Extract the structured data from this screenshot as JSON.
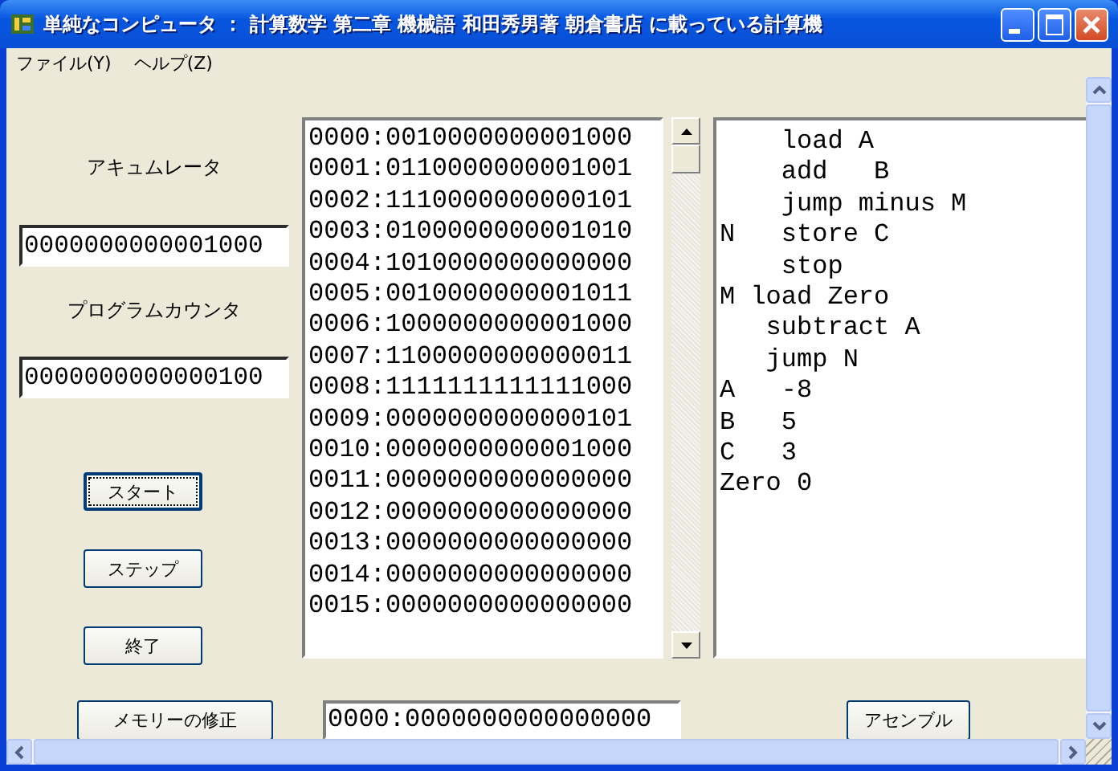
{
  "window": {
    "title": "単純なコンピュータ ： 計算数学 第二章 機械語 和田秀男著 朝倉書店 に載っている計算機"
  },
  "menu": [
    {
      "label": "ファイル(Y)"
    },
    {
      "label": "ヘルプ(Z)"
    }
  ],
  "registers": [
    {
      "label": "アキュムレータ",
      "value": "0000000000001000"
    },
    {
      "label": "プログラムカウンタ",
      "value": "0000000000000100"
    }
  ],
  "buttons": [
    {
      "label": "スタート",
      "focused": true
    },
    {
      "label": "ステップ",
      "focused": false
    },
    {
      "label": "終了",
      "focused": false
    }
  ],
  "memory": [
    "0000:0010000000001000",
    "0001:0110000000001001",
    "0002:1110000000000101",
    "0003:0100000000001010",
    "0004:1010000000000000",
    "0005:0010000000001011",
    "0006:1000000000001000",
    "0007:1100000000000011",
    "0008:1111111111111000",
    "0009:0000000000000101",
    "0010:0000000000001000",
    "0011:0000000000000000",
    "0012:0000000000000000",
    "0013:0000000000000000",
    "0014:0000000000000000",
    "0015:0000000000000000"
  ],
  "code": [
    "    load A",
    "    add   B",
    "    jump minus M",
    "N   store C",
    "    stop",
    "M load Zero",
    "   subtract A",
    "   jump N",
    "A   -8",
    "B   5",
    "C   3",
    "Zero 0"
  ],
  "modify_button": {
    "label": "メモリーの修正"
  },
  "address_field": {
    "value": "0000:0000000000000000"
  },
  "assemble_button": {
    "label": "アセンブル"
  }
}
